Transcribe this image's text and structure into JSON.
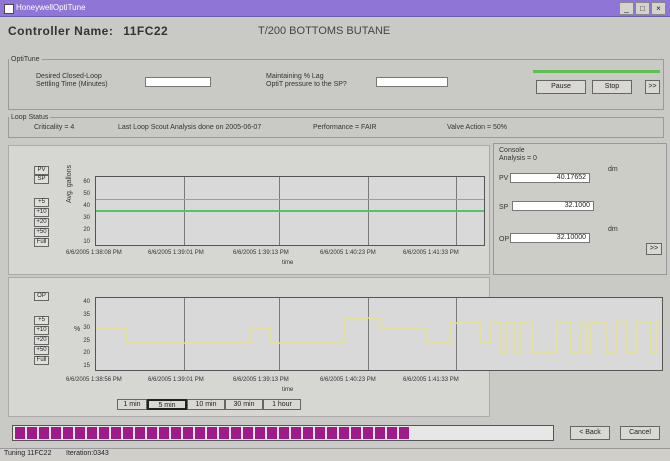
{
  "window": {
    "title": "HoneywellOptiTune",
    "min": "_",
    "max": "□",
    "close": "×"
  },
  "header": {
    "controller_label": "Controller Name:",
    "controller_name": "11FC22",
    "description": "T/200 BOTTOMS BUTANE"
  },
  "optitune": {
    "group": "OptiTune",
    "desired_label_1": "Desired Closed-Loop",
    "desired_label_2": "Settling Time (Minutes)",
    "desired_value": "",
    "maintain_label_1": "Maintaining % Lag",
    "maintain_label_2": "OptiT pressure to the SP?",
    "maintain_value": "",
    "buttons": {
      "pause": "Pause",
      "stop": "Stop",
      "more": ">>"
    }
  },
  "loop_status": {
    "group": "Loop Status",
    "criticality": "Criticality = 4",
    "last_scan": "Last Loop Scout Analysis done on 2005-06-07",
    "performance": "Performance = FAIR",
    "valve_action": "Valve Action = 50%"
  },
  "chart_top": {
    "mode_labels": [
      "PV",
      "SP"
    ],
    "zoom_buttons": [
      "+5",
      "+10",
      "+20",
      "+50",
      "Full"
    ],
    "ylabel": "Avg. gallons",
    "xlabel": "time",
    "ytick_labels": [
      "60",
      "50",
      "40",
      "30",
      "20",
      "10"
    ],
    "xtick_labels": [
      "6/6/2005 1:38:08 PM",
      "6/6/2005 1:39:01 PM",
      "6/6/2005 1:39:13 PM",
      "6/6/2005 1:40:23 PM",
      "6/6/2005 1:41:33 PM"
    ]
  },
  "chart_bottom": {
    "mode_label": "OP",
    "zoom_buttons": [
      "+5",
      "+10",
      "+20",
      "+50",
      "Full"
    ],
    "ylabel": "%",
    "xlabel": "time",
    "ytick_labels": [
      "40",
      "35",
      "30",
      "25",
      "20",
      "15"
    ],
    "xtick_labels": [
      "6/6/2005 1:38:56 PM",
      "6/6/2005 1:39:01 PM",
      "6/6/2005 1:39:13 PM",
      "6/6/2005 1:40:23 PM",
      "6/6/2005 1:41:33 PM"
    ]
  },
  "time_buttons": [
    "1 min",
    "5 min",
    "10 min",
    "30 min",
    "1 hour"
  ],
  "console": {
    "group": "Console",
    "subtitle": "Analysis = 0",
    "pv_label": "PV",
    "pv_value": "40.17652",
    "sp_label": "SP",
    "sp_value": "32.1000",
    "op_label": "OP",
    "op_value": "32.10000",
    "unit1": "dm",
    "unit2": "dm",
    "more": ">>"
  },
  "footer": {
    "back": "< Back",
    "cancel": "Cancel",
    "status_left": "Tuning 11FC22",
    "status_right": "Iteration:0343"
  },
  "progress": {
    "fraction": 0.74,
    "color": "#a01a8a"
  },
  "colors": {
    "titlebar": "#8f76d6",
    "pv_line": "#5fb3d8",
    "sp_line": "#56c265",
    "op_line": "#e8e28a"
  }
}
